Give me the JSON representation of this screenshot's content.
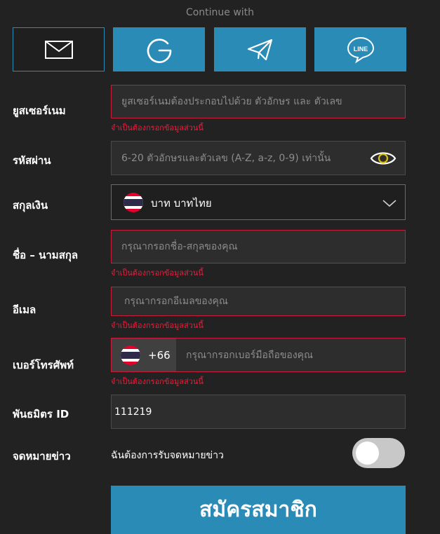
{
  "header": {
    "continue_with": "Continue with"
  },
  "social": [
    {
      "name": "email",
      "icon": "envelope-icon"
    },
    {
      "name": "google",
      "icon": "google-icon"
    },
    {
      "name": "telegram",
      "icon": "telegram-icon"
    },
    {
      "name": "line",
      "icon": "line-icon",
      "text": "LINE"
    }
  ],
  "form": {
    "username": {
      "label": "ยูสเซอร์เนม",
      "placeholder": "ยูสเซอร์เนมต้องประกอบไปด้วย ตัวอักษร และ ตัวเลข",
      "error": "จำเป็นต้องกรอกข้อมูลส่วนนี้"
    },
    "password": {
      "label": "รหัสผ่าน",
      "placeholder": "6-20 ตัวอักษรและตัวเลข (A-Z, a-z, 0-9) เท่านั้น"
    },
    "currency": {
      "label": "สกุลเงิน",
      "value": "บาท บาทไทย"
    },
    "fullname": {
      "label": "ชื่อ – นามสกุล",
      "placeholder": "กรุณากรอกชื่อ-สกุลของคุณ",
      "error": "จำเป็นต้องกรอกข้อมูลส่วนนี้"
    },
    "email": {
      "label": "อีเมล",
      "placeholder": "กรุณากรอกอีเมลของคุณ",
      "error": "จำเป็นต้องกรอกข้อมูลส่วนนี้"
    },
    "phone": {
      "label": "เบอร์โทรศัพท์",
      "country_code": "+66",
      "placeholder": "กรุณากรอกเบอร์มือถือของคุณ",
      "error": "จำเป็นต้องกรอกข้อมูลส่วนนี้"
    },
    "affiliate": {
      "label": "พันธมิตร ID",
      "value": "111219"
    },
    "newsletter": {
      "label": "จดหมายข่าว",
      "text": "ฉันต้องการรับจดหมายข่าว",
      "enabled": false
    },
    "submit_label": "สมัครสมาชิก"
  },
  "colors": {
    "background": "#222222",
    "accent": "#2a8bb6",
    "error": "#e5213f",
    "field_bg": "#2d2d2d"
  }
}
